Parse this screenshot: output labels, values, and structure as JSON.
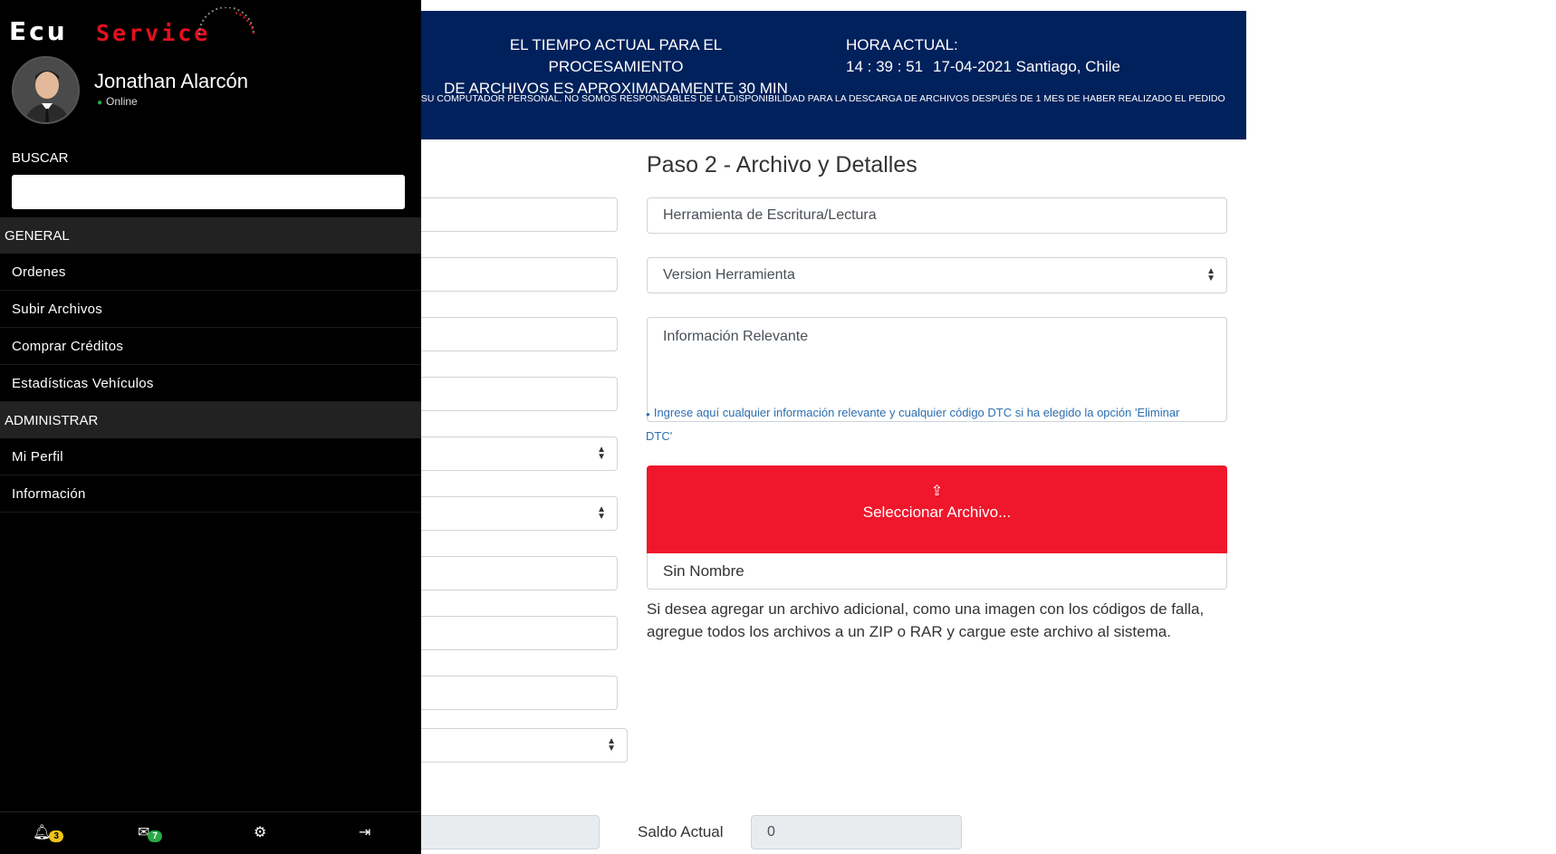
{
  "banner": {
    "processing_line1": "EL TIEMPO ACTUAL PARA EL PROCESAMIENTO",
    "processing_line2": "DE ARCHIVOS ES APROXIMADAMENTE 30 MIN",
    "hora_label": "HORA ACTUAL:",
    "hora_value": "14 : 39 : 51",
    "fecha_lugar": "17-04-2021 Santiago, Chile",
    "disclaimer": "EN SU COMPUTADOR PERSONAL. NO SOMOS RESPONSABLES DE LA DISPONIBILIDAD PARA LA DESCARGA DE ARCHIVOS DESPUÉS DE 1 MES DE HABER REALIZADO EL PEDIDO"
  },
  "step2": {
    "title": "Paso 2 - Archivo y Detalles",
    "herramienta_placeholder": "Herramienta de Escritura/Lectura",
    "version_selected": "Version Herramienta",
    "info_placeholder": "Información Relevante",
    "hint": "Ingrese aquí cualquier información relevante y cualquier código DTC si ha elegido la opción 'Eliminar DTC'",
    "upload_label": "Seleccionar Archivo...",
    "file_name": "Sin Nombre",
    "help_text": "Si desea agregar un archivo adicional, como una imagen con los códigos de falla, agregue todos los archivos a un ZIP o RAR y cargue este archivo al sistema."
  },
  "footer_form": {
    "saldo_label": "Saldo Actual",
    "saldo_value": "0"
  },
  "sidebar": {
    "logo_ecu": "Ecu",
    "logo_service": "Service",
    "user_name": "Jonathan Alarcón",
    "user_status": "Online",
    "buscar_label": "BUSCAR",
    "section_general": "GENERAL",
    "general_items": [
      "Ordenes",
      "Subir Archivos",
      "Comprar Créditos",
      "Estadísticas Vehículos"
    ],
    "section_admin": "ADMINISTRAR",
    "admin_items": [
      "Mi Perfil",
      "Información"
    ],
    "bottom": {
      "notifications_count": "3",
      "messages_count": "7"
    }
  },
  "colors": {
    "banner_bg": "#00215b",
    "upload_bg": "#f0162b",
    "sidebar_bg": "#000000",
    "badge_yellow": "#f0c419",
    "badge_green": "#28a745"
  }
}
